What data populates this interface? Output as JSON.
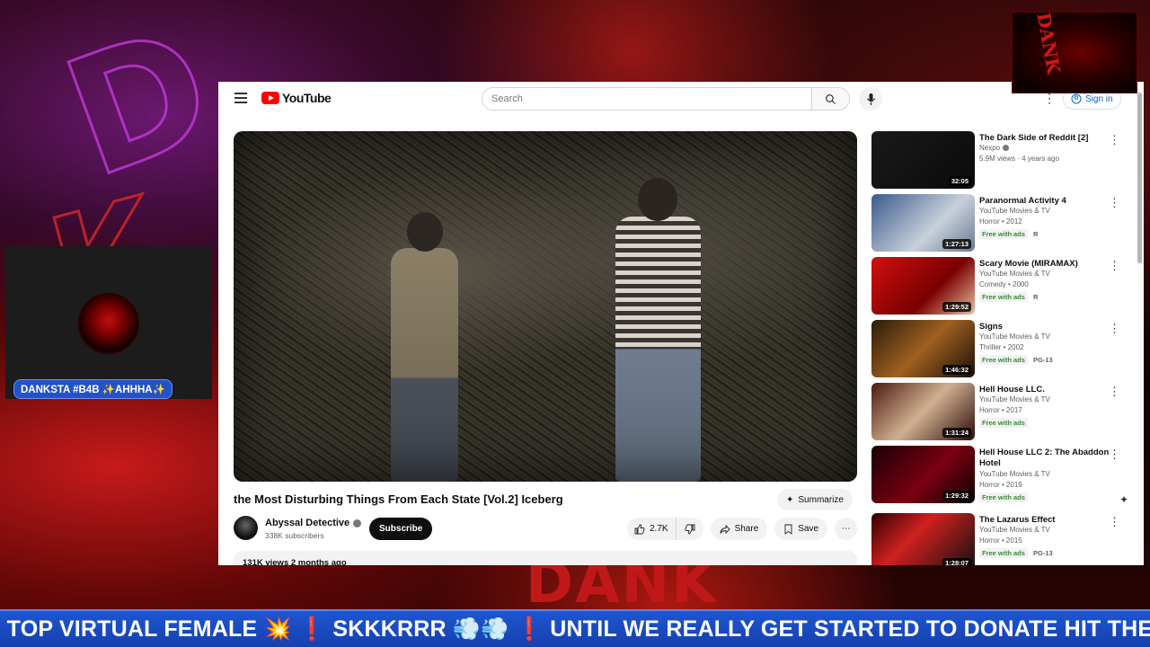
{
  "youtube": {
    "logo_text": "YouTube",
    "search_placeholder": "Search",
    "sign_in_label": "Sign in"
  },
  "video": {
    "title": "the Most Disturbing Things From Each State [Vol.2] Iceberg",
    "summarize_label": "Summarize",
    "channel_name": "Abyssal Detective",
    "subscribers": "338K subscribers",
    "subscribe_label": "Subscribe",
    "likes": "2.7K",
    "share_label": "Share",
    "save_label": "Save",
    "views_and_date": "131K views  2 months ago"
  },
  "recommendations": [
    {
      "title": "The Dark Side of Reddit [2]",
      "channel": "Nexpo",
      "verified": true,
      "meta": "5.9M views · 4 years ago",
      "duration": "32:05",
      "badges": [],
      "rating": ""
    },
    {
      "title": "Paranormal Activity 4",
      "channel": "YouTube Movies & TV",
      "verified": false,
      "meta": "Horror • 2012",
      "duration": "1:27:13",
      "badges": [
        "Free with ads"
      ],
      "rating": "R"
    },
    {
      "title": "Scary Movie (MIRAMAX)",
      "channel": "YouTube Movies & TV",
      "verified": false,
      "meta": "Comedy • 2000",
      "duration": "1:29:52",
      "badges": [
        "Free with ads"
      ],
      "rating": "R"
    },
    {
      "title": "Signs",
      "channel": "YouTube Movies & TV",
      "verified": false,
      "meta": "Thriller • 2002",
      "duration": "1:46:32",
      "badges": [
        "Free with ads"
      ],
      "rating": "PG-13"
    },
    {
      "title": "Hell House LLC.",
      "channel": "YouTube Movies & TV",
      "verified": false,
      "meta": "Horror • 2017",
      "duration": "1:31:24",
      "badges": [
        "Free with ads"
      ],
      "rating": ""
    },
    {
      "title": "Hell House LLC 2: The Abaddon Hotel",
      "channel": "YouTube Movies & TV",
      "verified": false,
      "meta": "Horror • 2019",
      "duration": "1:29:32",
      "badges": [
        "Free with ads"
      ],
      "rating": ""
    },
    {
      "title": "The Lazarus Effect",
      "channel": "YouTube Movies & TV",
      "verified": false,
      "meta": "Horror • 2015",
      "duration": "1:28:07",
      "badges": [
        "Free with ads"
      ],
      "rating": "PG-13"
    }
  ],
  "stream": {
    "cam_label": "DANKSTA #B4B ✨AHHHA✨",
    "ticker": "· TOP VIRTUAL FEMALE 💥 ❗ SKKKRRR 💨💨 ❗ UNTIL WE REALLY GET STARTED TO DONATE HIT THE C",
    "logo_text": "DANK",
    "background_text": "DANK"
  }
}
